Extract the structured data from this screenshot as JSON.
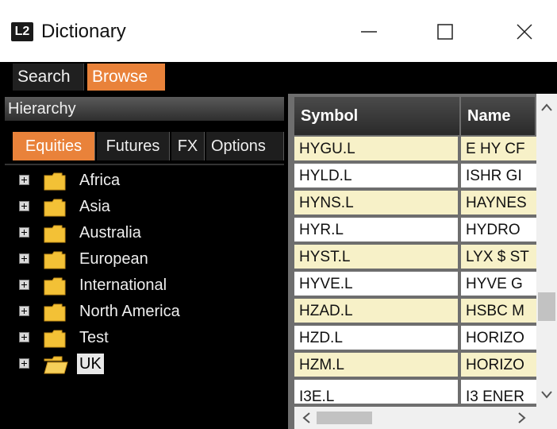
{
  "window": {
    "logo": "L2",
    "title": "Dictionary"
  },
  "mode_tabs": {
    "search": "Search",
    "browse": "Browse"
  },
  "left": {
    "header": "Hierarchy",
    "category_tabs": {
      "equities": "Equities",
      "futures": "Futures",
      "fx": "FX",
      "options": "Options"
    },
    "tree": [
      {
        "label": "Africa"
      },
      {
        "label": "Asia"
      },
      {
        "label": "Australia"
      },
      {
        "label": "European"
      },
      {
        "label": "International"
      },
      {
        "label": "North America"
      },
      {
        "label": "Test"
      },
      {
        "label": "UK",
        "selected": true
      }
    ]
  },
  "table": {
    "columns": {
      "symbol": "Symbol",
      "name": "Name"
    },
    "rows": [
      {
        "symbol": "HYGU.L",
        "name": "E HY CF"
      },
      {
        "symbol": "HYLD.L",
        "name": "ISHR GI"
      },
      {
        "symbol": "HYNS.L",
        "name": "HAYNES"
      },
      {
        "symbol": "HYR.L",
        "name": "HYDRO"
      },
      {
        "symbol": "HYST.L",
        "name": "LYX $ ST"
      },
      {
        "symbol": "HYVE.L",
        "name": "HYVE G"
      },
      {
        "symbol": "HZAD.L",
        "name": "HSBC M"
      },
      {
        "symbol": "HZD.L",
        "name": "HORIZO"
      },
      {
        "symbol": "HZM.L",
        "name": "HORIZO"
      },
      {
        "symbol": "I3E.L",
        "name": "I3 ENER"
      }
    ]
  },
  "colors": {
    "accent": "#e9823a",
    "row_highlight": "#f7f1c8",
    "folder": "#f3c136"
  },
  "icons": {
    "logo": "l2-logo-icon",
    "minimize": "minimize-icon",
    "maximize": "maximize-icon",
    "close": "close-icon",
    "expander": "plus-box-icon",
    "folder": "folder-icon"
  }
}
